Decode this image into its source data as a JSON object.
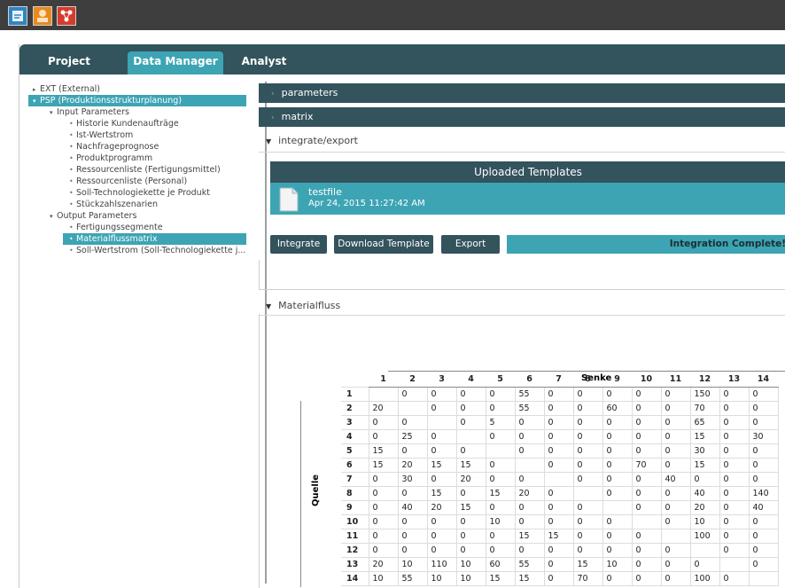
{
  "tabs": [
    "Project",
    "Data Manager",
    "Analyst"
  ],
  "tree": {
    "ext": "EXT (External)",
    "psp": "PSP (Produktionsstrukturplanung)",
    "input_parameters": "Input Parameters",
    "input_items": [
      "Historie Kundenaufträge",
      "Ist-Wertstrom",
      "Nachfrageprognose",
      "Produktprogramm",
      "Ressourcenliste (Fertigungsmittel)",
      "Ressourcenliste (Personal)",
      "Soll-Technologiekette je Produkt",
      "Stückzahlszenarien"
    ],
    "output_parameters": "Output Parameters",
    "output_items": [
      "Fertigungssegmente",
      "Materialflussmatrix",
      "Soll-Wertstrom (Soll-Technologiekette j..."
    ]
  },
  "panels": {
    "parameters": "parameters",
    "matrix": "matrix",
    "integrate_export": "integrate/export",
    "materialfluss": "Materialfluss"
  },
  "uploaded": {
    "title": "Uploaded Templates",
    "file_name": "testfile",
    "file_date": "Apr 24, 2015 11:27:42 AM"
  },
  "buttons": {
    "integrate": "Integrate",
    "download": "Download Template",
    "export": "Export"
  },
  "status": "Integration Complete!",
  "matrix": {
    "senke_label": "Senke",
    "quelle_label": "Quelle",
    "columns": [
      "1",
      "2",
      "3",
      "4",
      "5",
      "6",
      "7",
      "8",
      "9",
      "10",
      "11",
      "12",
      "13",
      "14"
    ],
    "rows": [
      {
        "label": "1",
        "cells": [
          "",
          "0",
          "0",
          "0",
          "0",
          "55",
          "0",
          "0",
          "0",
          "0",
          "0",
          "150",
          "0",
          "0"
        ]
      },
      {
        "label": "2",
        "cells": [
          "20",
          "",
          "0",
          "0",
          "0",
          "55",
          "0",
          "0",
          "60",
          "0",
          "0",
          "70",
          "0",
          "0"
        ]
      },
      {
        "label": "3",
        "cells": [
          "0",
          "0",
          "",
          "0",
          "5",
          "0",
          "0",
          "0",
          "0",
          "0",
          "0",
          "65",
          "0",
          "0"
        ]
      },
      {
        "label": "4",
        "cells": [
          "0",
          "25",
          "0",
          "",
          "0",
          "0",
          "0",
          "0",
          "0",
          "0",
          "0",
          "15",
          "0",
          "30"
        ]
      },
      {
        "label": "5",
        "cells": [
          "15",
          "0",
          "0",
          "0",
          "",
          "0",
          "0",
          "0",
          "0",
          "0",
          "0",
          "30",
          "0",
          "0"
        ]
      },
      {
        "label": "6",
        "cells": [
          "15",
          "20",
          "15",
          "15",
          "0",
          "",
          "0",
          "0",
          "0",
          "70",
          "0",
          "15",
          "0",
          "0"
        ]
      },
      {
        "label": "7",
        "cells": [
          "0",
          "30",
          "0",
          "20",
          "0",
          "0",
          "",
          "0",
          "0",
          "0",
          "40",
          "0",
          "0",
          "0"
        ]
      },
      {
        "label": "8",
        "cells": [
          "0",
          "0",
          "15",
          "0",
          "15",
          "20",
          "0",
          "",
          "0",
          "0",
          "0",
          "40",
          "0",
          "140"
        ]
      },
      {
        "label": "9",
        "cells": [
          "0",
          "40",
          "20",
          "15",
          "0",
          "0",
          "0",
          "0",
          "",
          "0",
          "0",
          "20",
          "0",
          "40"
        ]
      },
      {
        "label": "10",
        "cells": [
          "0",
          "0",
          "0",
          "0",
          "10",
          "0",
          "0",
          "0",
          "0",
          "",
          "0",
          "10",
          "0",
          "0"
        ]
      },
      {
        "label": "11",
        "cells": [
          "0",
          "0",
          "0",
          "0",
          "0",
          "15",
          "15",
          "0",
          "0",
          "0",
          "",
          "100",
          "0",
          "0"
        ]
      },
      {
        "label": "12",
        "cells": [
          "0",
          "0",
          "0",
          "0",
          "0",
          "0",
          "0",
          "0",
          "0",
          "0",
          "0",
          "",
          "0",
          "0"
        ]
      },
      {
        "label": "13",
        "cells": [
          "20",
          "10",
          "110",
          "10",
          "60",
          "55",
          "0",
          "15",
          "10",
          "0",
          "0",
          "0",
          "",
          "0"
        ]
      },
      {
        "label": "14",
        "cells": [
          "10",
          "55",
          "10",
          "10",
          "15",
          "15",
          "0",
          "70",
          "0",
          "0",
          "0",
          "100",
          "0",
          ""
        ]
      }
    ]
  }
}
